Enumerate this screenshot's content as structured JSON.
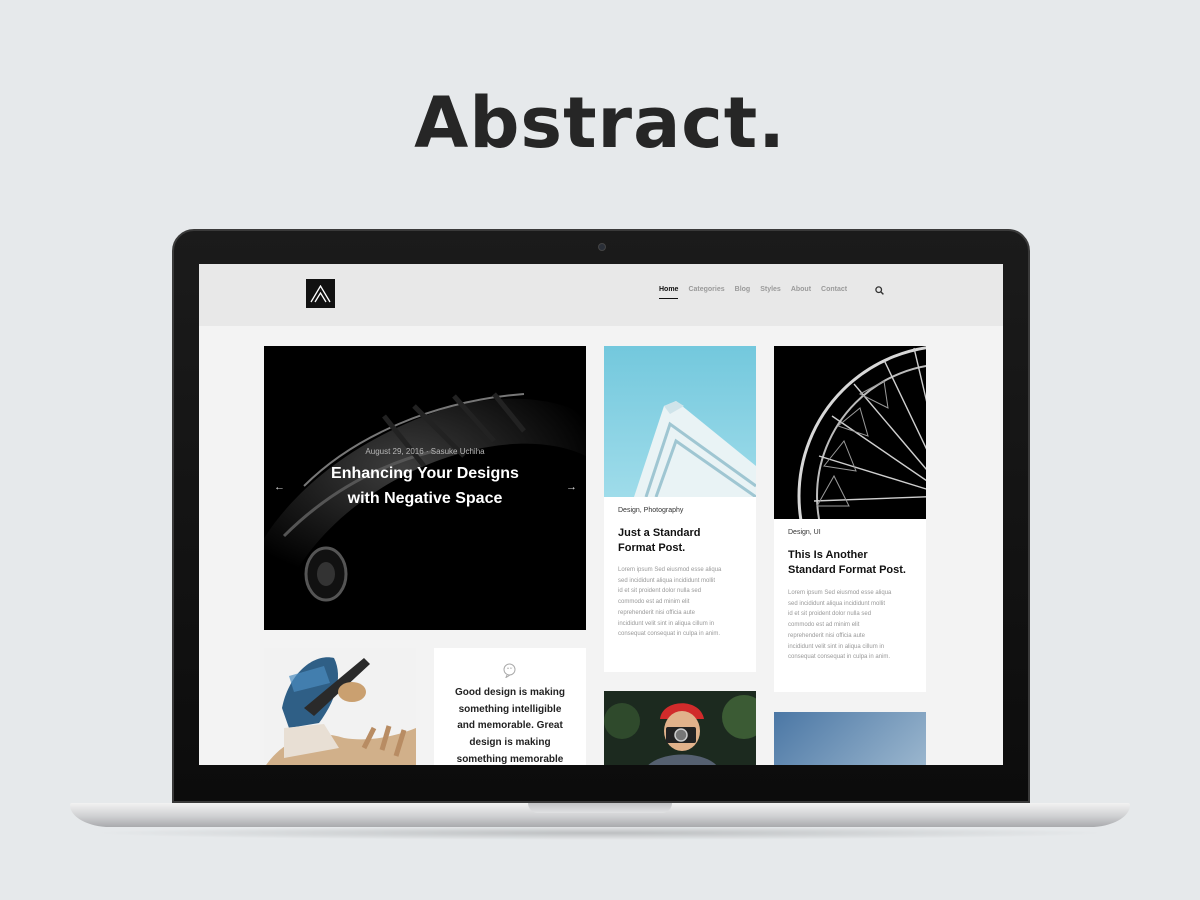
{
  "hero": {
    "title": "Abstract."
  },
  "site": {
    "logo_icon": "abstract-a-logo-icon",
    "nav": [
      "Home",
      "Categories",
      "Blog",
      "Styles",
      "About",
      "Contact"
    ],
    "active_nav": "Home",
    "search_icon": "search-icon"
  },
  "featured": {
    "meta": "August 29, 2016 · Sasuke Uchiha",
    "title_line1": "Enhancing Your Designs",
    "title_line2": "with Negative Space"
  },
  "posts": [
    {
      "category": "Design, Photography",
      "title_line1": "Just a Standard",
      "title_line2": "Format Post.",
      "excerpt": [
        "Lorem ipsum Sed eiusmod esse aliqua",
        "sed incididunt aliqua incididunt mollit",
        "id et sit proident dolor nulla sed",
        "commodo est ad minim elit",
        "reprehenderit nisi officia aute",
        "incididunt velit sint in aliqua cillum in",
        "consequat consequat in culpa in anim."
      ]
    },
    {
      "category": "Design, UI",
      "title_line1": "This Is Another",
      "title_line2": "Standard Format Post.",
      "excerpt": [
        "Lorem ipsum Sed eiusmod esse aliqua",
        "sed incididunt aliqua incididunt mollit",
        "id et sit proident dolor nulla sed",
        "commodo est ad minim elit",
        "reprehenderit nisi officia aute",
        "incididunt velit sint in aliqua cillum in",
        "consequat consequat in culpa in anim."
      ]
    }
  ],
  "quote": {
    "lines": [
      "Good design is making",
      "something intelligible",
      "and memorable. Great",
      "design is making",
      "something memorable"
    ]
  }
}
